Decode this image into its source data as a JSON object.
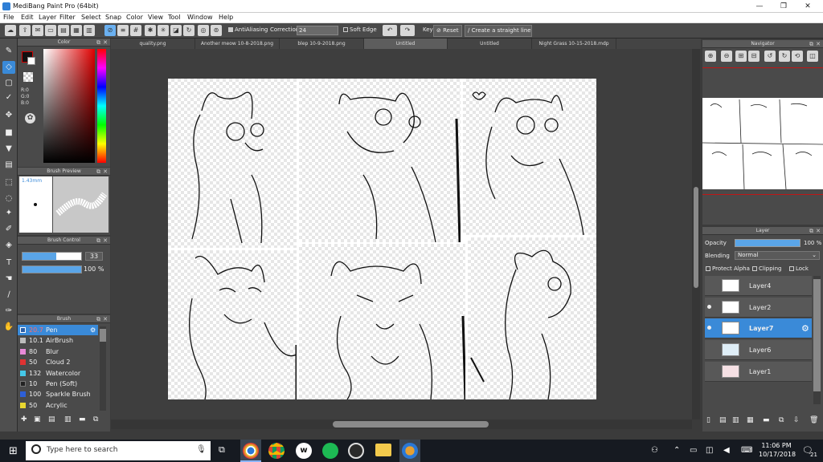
{
  "window": {
    "title": "MediBang Paint Pro (64bit)",
    "min": "—",
    "max": "❐",
    "close": "✕"
  },
  "menu": [
    "File",
    "Edit",
    "Layer",
    "Filter",
    "Select",
    "Snap",
    "Color",
    "View",
    "Tool",
    "Window",
    "Help"
  ],
  "toolbar": {
    "antialias": "AntiAliasing",
    "correction_label": "Correction",
    "correction_value": "24",
    "soft_edge": "Soft Edge",
    "key": "Key",
    "reset": "Reset",
    "straight_line": "Create a straight line"
  },
  "tabs": [
    "quality.png",
    "Another meow 10-8-2018.png",
    "blep 10-9-2018.png",
    "Untitled",
    "Untitled",
    "Night Grass 10-15-2018.mdp"
  ],
  "panels": {
    "color": "Color",
    "brush_preview": "Brush Preview",
    "brush_size": "1.43mm",
    "brush_control": "Brush Control",
    "brush_control_size": "33",
    "brush_control_opacity": "100 %",
    "brush": "Brush",
    "navigator": "Navigator",
    "layer": "Layer"
  },
  "color_values": {
    "r": "R:0",
    "g": "G:0",
    "b": "B:0"
  },
  "brushes": [
    {
      "size": "20.7",
      "name": "Pen",
      "color": "#2b5fa8"
    },
    {
      "size": "10.1",
      "name": "AirBrush",
      "color": "#bdbdbd"
    },
    {
      "size": "80",
      "name": "Blur",
      "color": "#e88ad8"
    },
    {
      "size": "50",
      "name": "Cloud 2",
      "color": "#e03232"
    },
    {
      "size": "132",
      "name": "Watercolor",
      "color": "#45c8e8"
    },
    {
      "size": "10",
      "name": "Pen (Soft)",
      "color": "#222222"
    },
    {
      "size": "100",
      "name": "Sparkle Brush",
      "color": "#2d5fd8"
    },
    {
      "size": "50",
      "name": "Acrylic",
      "color": "#e8d630"
    }
  ],
  "layer_panel": {
    "opacity_label": "Opacity",
    "opacity_value": "100 %",
    "blending_label": "Blending",
    "blending_value": "Normal",
    "protect_alpha": "Protect Alpha",
    "clipping": "Clipping",
    "lock": "Lock"
  },
  "layers": [
    {
      "name": "Layer4",
      "visible": false,
      "selected": false
    },
    {
      "name": "Layer2",
      "visible": true,
      "selected": false
    },
    {
      "name": "Layer7",
      "visible": true,
      "selected": true
    },
    {
      "name": "Layer6",
      "visible": false,
      "selected": false
    },
    {
      "name": "Layer1",
      "visible": false,
      "selected": false
    }
  ],
  "taskbar": {
    "search_placeholder": "Type here to search",
    "time": "11:06 PM",
    "date": "10/17/2018",
    "notification_count": "21"
  },
  "accent": "#3a8ad8"
}
